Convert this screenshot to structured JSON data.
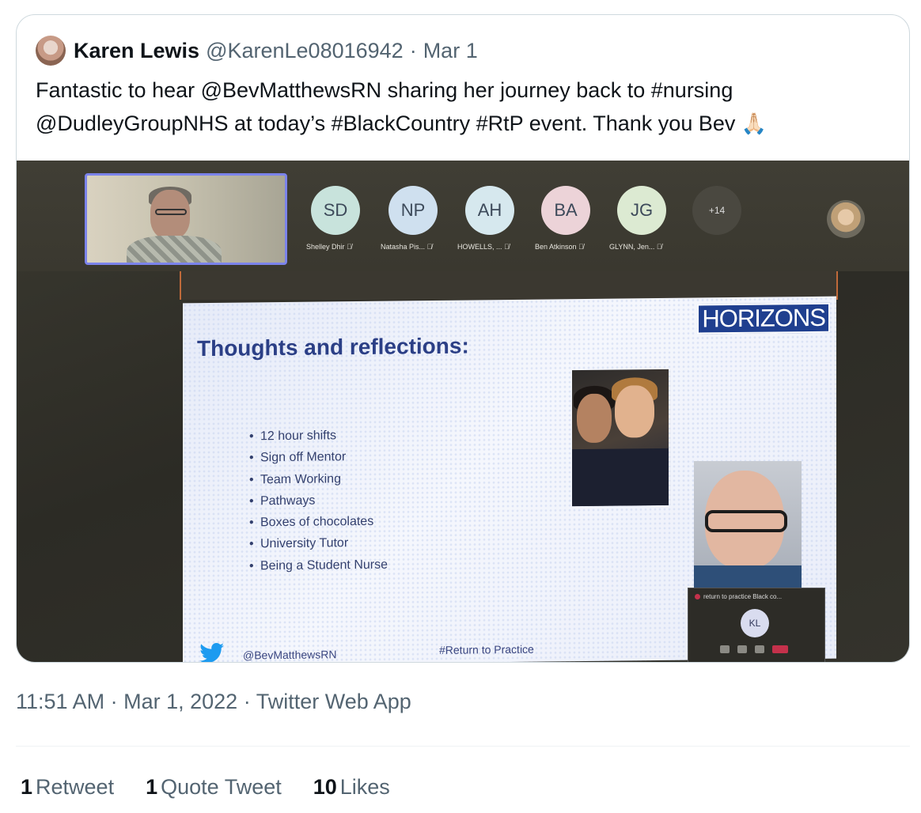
{
  "quoted": {
    "name": "Karen Lewis",
    "handle": "@KarenLe08016942",
    "separator": "·",
    "date": "Mar 1",
    "text": "Fantastic to hear @BevMatthewsRN sharing her journey back to #nursing @DudleyGroupNHS at today’s #BlackCountry #RtP event. Thank you Bev",
    "emoji": "🙏🏻",
    "media": {
      "participants": [
        {
          "initials": "SD",
          "label": "Shelley Dhir",
          "color": "#c8e3dc"
        },
        {
          "initials": "NP",
          "label": "Natasha Pis...",
          "color": "#cfe0ef"
        },
        {
          "initials": "AH",
          "label": "HOWELLS, ...",
          "color": "#d6e8ee"
        },
        {
          "initials": "BA",
          "label": "Ben Atkinson",
          "color": "#ecd3d8"
        },
        {
          "initials": "JG",
          "label": "GLYNN, Jen...",
          "color": "#dcead2"
        }
      ],
      "more_count": "+14",
      "slide": {
        "brand": "HORIZONS",
        "title": "Thoughts and reflections:",
        "bullets": [
          "12 hour shifts",
          "Sign off Mentor",
          "Team Working",
          "Pathways",
          "Boxes of chocolates",
          "University Tutor",
          "Being a Student Nurse"
        ],
        "footer_handle": "@BevMatthewsRN",
        "footer_tag": "#Return to Practice"
      },
      "mini_window": {
        "title": "return to practice Black co...",
        "initials": "KL"
      }
    }
  },
  "meta": {
    "time": "11:51 AM",
    "separator1": "·",
    "date": "Mar 1, 2022",
    "separator2": "·",
    "source": "Twitter Web App"
  },
  "stats": {
    "retweets_count": "1",
    "retweets_label": "Retweet",
    "quotes_count": "1",
    "quotes_label": "Quote Tweet",
    "likes_count": "10",
    "likes_label": "Likes"
  },
  "colors": {
    "text_primary": "#0f1419",
    "text_secondary": "#536471",
    "border": "#cfd9de",
    "teams_accent": "#7b83eb",
    "slide_brand": "#1f3f8f"
  }
}
